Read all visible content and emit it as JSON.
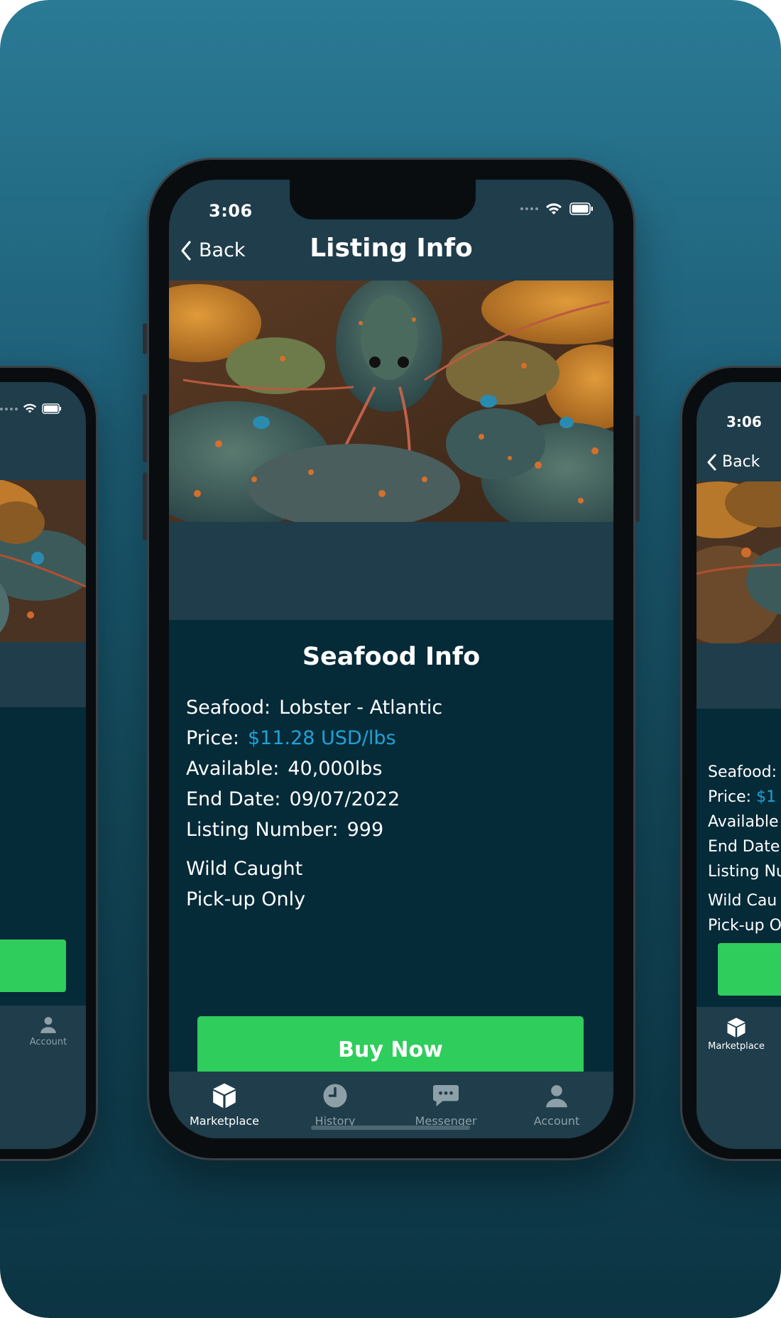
{
  "status": {
    "time": "3:06"
  },
  "nav": {
    "back_label": "Back",
    "title": "Listing Info"
  },
  "hero": {
    "alt": "Atlantic lobsters"
  },
  "info": {
    "title": "Seafood Info",
    "seafood_label": "Seafood:",
    "seafood_value": "Lobster - Atlantic",
    "price_label": "Price:",
    "price_value": "$11.28 USD/lbs",
    "available_label": "Available:",
    "available_value": "40,000lbs",
    "end_date_label": "End Date:",
    "end_date_value": "09/07/2022",
    "listing_label": "Listing Number:",
    "listing_value": "999",
    "attr_1": "Wild Caught",
    "attr_2": "Pick-up Only"
  },
  "buy_button": "Buy Now",
  "tabs": [
    {
      "label": "Marketplace",
      "icon": "box-icon",
      "active": true
    },
    {
      "label": "History",
      "icon": "clock-icon",
      "active": false
    },
    {
      "label": "Messenger",
      "icon": "chat-icon",
      "active": false
    },
    {
      "label": "Account",
      "icon": "person-icon",
      "active": false
    }
  ],
  "left_phone": {
    "tab_label": "Account"
  },
  "right_phone": {
    "time": "3:06",
    "back_label": "Back",
    "seafood_label": "Seafood:",
    "price_label": "Price:",
    "price_partial": "$1",
    "available_partial": "Available",
    "end_date_partial": "End Date",
    "listing_partial": "Listing Nu",
    "attr_1_partial": "Wild Cau",
    "attr_2_partial": "Pick-up O",
    "tab_label": "Marketplace"
  },
  "colors": {
    "accent_price": "#1fa3d6",
    "buy_button": "#2fcd5c",
    "info_bg": "#052a38",
    "nav_bg": "#1f3d4b"
  }
}
